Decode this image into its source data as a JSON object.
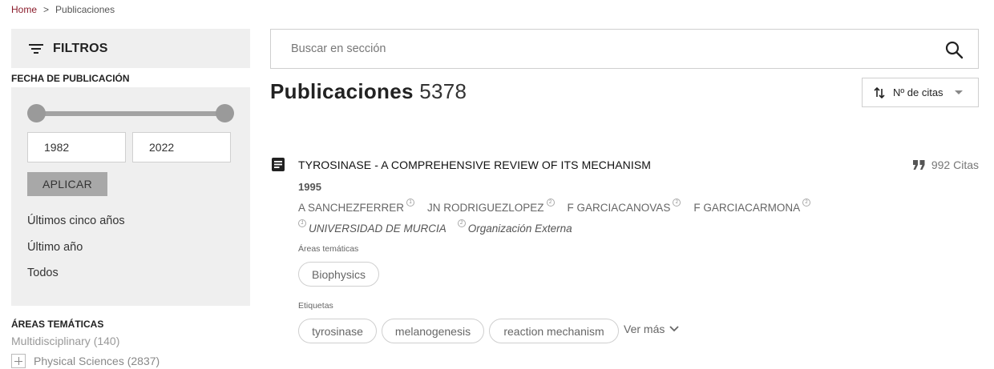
{
  "breadcrumb": {
    "home": "Home",
    "separator": ">",
    "current": "Publicaciones"
  },
  "sidebar": {
    "filters_title": "FILTROS",
    "date_section_title": "FECHA DE PUBLICACIÓN",
    "year_from": "1982",
    "year_to": "2022",
    "apply_label": "APLICAR",
    "quick_ranges": [
      "Últimos cinco años",
      "Último año",
      "Todos"
    ],
    "areas_title": "ÁREAS TEMÁTICAS",
    "areas": [
      {
        "label": "Multidisciplinary (140)"
      },
      {
        "label": "Physical Sciences (2837)"
      }
    ]
  },
  "search": {
    "placeholder": "Buscar en sección"
  },
  "header": {
    "title": "Publicaciones",
    "count": "5378",
    "sort_label": "Nº de citas"
  },
  "publication": {
    "title": "TYROSINASE - A COMPREHENSIVE REVIEW OF ITS MECHANISM",
    "citations": "992 Citas",
    "year": "1995",
    "authors": [
      {
        "name": "A SANCHEZFERRER",
        "ref": "1"
      },
      {
        "name": "JN RODRIGUEZLOPEZ",
        "ref": "2"
      },
      {
        "name": "F GARCIACANOVAS",
        "ref": "2"
      },
      {
        "name": "F GARCIACARMONA",
        "ref": "2"
      }
    ],
    "affiliations": [
      {
        "ref": "1",
        "name": "UNIVERSIDAD DE MURCIA"
      },
      {
        "ref": "2",
        "name": "Organización Externa"
      }
    ],
    "areas_label": "Áreas temáticas",
    "areas": [
      "Biophysics"
    ],
    "tags_label": "Etiquetas",
    "tags": [
      "tyrosinase",
      "melanogenesis",
      "reaction mechanism"
    ],
    "more_label": "Ver más"
  },
  "colors": {
    "brand": "#8b1c2b",
    "panel_bg": "#efefef",
    "slider": "#9a9a9a",
    "apply_bg": "#a8a8a8"
  }
}
